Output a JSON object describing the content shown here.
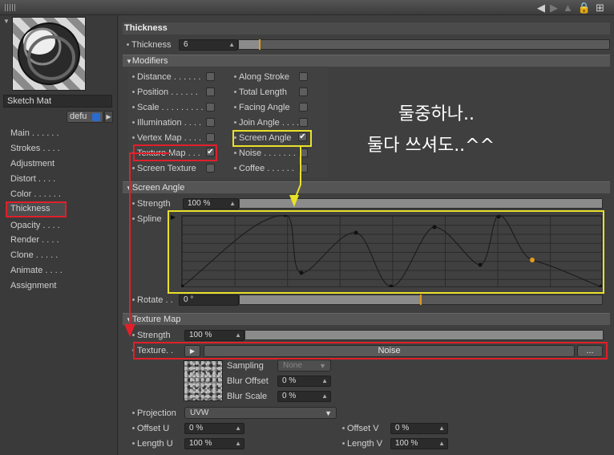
{
  "left": {
    "material_name": "Sketch Mat",
    "default_label": "defu",
    "nav": [
      "Main . . . . . .",
      "Strokes . . . .",
      "Adjustment",
      "Distort . . . .",
      "Color . . . . . .",
      "Thickness",
      "Opacity . . . .",
      "Render . . . .",
      "Clone . . . . .",
      "Animate . . . .",
      "Assignment"
    ]
  },
  "panel": {
    "title": "Thickness",
    "thickness_label": "Thickness",
    "thickness_value": "6",
    "modifiers_header": "Modifiers",
    "modifiers_col1": [
      {
        "label": "Distance . . . . . .",
        "checked": false
      },
      {
        "label": "Position . . . . . .",
        "checked": false
      },
      {
        "label": "Scale . . . . . . . . .",
        "checked": false
      },
      {
        "label": "Illumination . . . .",
        "checked": false
      },
      {
        "label": "Vertex Map . . . .",
        "checked": false
      },
      {
        "label": "Texture Map . . .",
        "checked": true
      },
      {
        "label": "Screen Texture",
        "checked": false
      }
    ],
    "modifiers_col2": [
      {
        "label": "Along Stroke",
        "checked": false
      },
      {
        "label": "Total Length",
        "checked": false
      },
      {
        "label": "Facing Angle",
        "checked": false
      },
      {
        "label": "Join Angle . . . .",
        "checked": false
      },
      {
        "label": "Screen Angle",
        "checked": true
      },
      {
        "label": "Noise . . . . . . .",
        "checked": false
      },
      {
        "label": "Coffee . . . . . .",
        "checked": false
      }
    ],
    "check_mark": "✔",
    "screen_angle_header": "Screen Angle",
    "strength_label": "Strength",
    "strength_value": "100 %",
    "spline_label": "Spline",
    "rotate_label": "Rotate . .",
    "rotate_value": "0 °",
    "texture_map_header": "Texture Map",
    "tm_strength_label": "Strength",
    "tm_strength_value": "100 %",
    "texture_label": "Texture. .",
    "texture_button": "Noise",
    "more_button": "...",
    "sampling_label": "Sampling",
    "sampling_value": "None",
    "blur_offset_label": "Blur Offset",
    "blur_offset_value": "0 %",
    "blur_scale_label": "Blur Scale",
    "blur_scale_value": "0 %",
    "projection_label": "Projection",
    "projection_value": "UVW",
    "offset_u_label": "Offset U",
    "offset_u_value": "0 %",
    "offset_v_label": "Offset V",
    "offset_v_value": "0 %",
    "length_u_label": "Length U",
    "length_u_value": "100 %",
    "length_v_label": "Length V",
    "length_v_value": "100 %"
  },
  "annotation": {
    "line1": "둘중하나..",
    "line2": "둘다 쓰셔도..^^"
  },
  "colors": {
    "highlight_red": "#e0202a",
    "highlight_yellow": "#e8e02a",
    "accent_orange": "#e39a1a"
  }
}
